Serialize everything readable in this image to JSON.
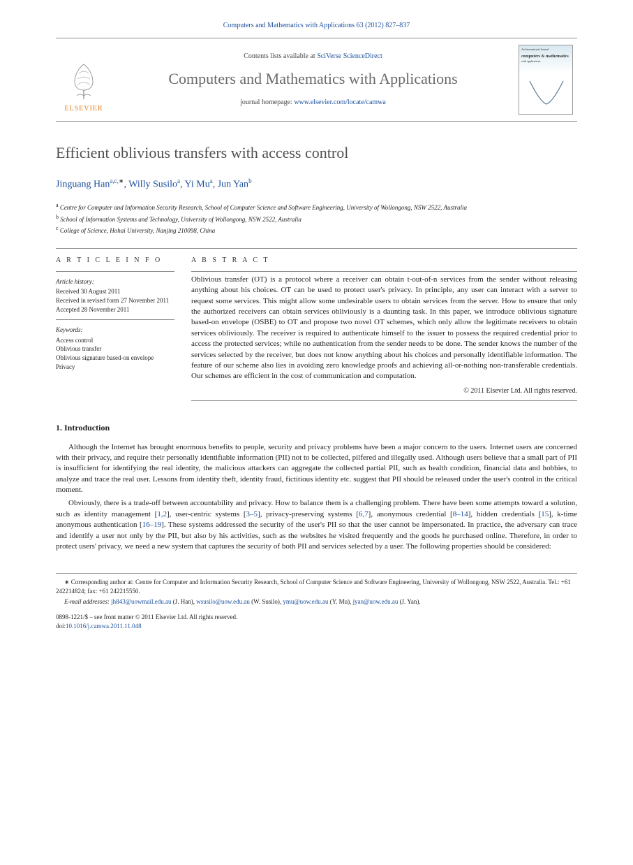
{
  "header": {
    "journal_citation": "Computers and Mathematics with Applications 63 (2012) 827–837",
    "contents_prefix": "Contents lists available at ",
    "contents_link": "SciVerse ScienceDirect",
    "journal_title": "Computers and Mathematics with Applications",
    "homepage_prefix": "journal homepage: ",
    "homepage_link": "www.elsevier.com/locate/camwa",
    "publisher": "ELSEVIER",
    "cover_title": "computers & mathematics",
    "cover_sub": "with applications"
  },
  "article": {
    "title": "Efficient oblivious transfers with access control",
    "authors_html": [
      {
        "name": "Jinguang Han",
        "affil": "a,c,",
        "star": true
      },
      {
        "name": "Willy Susilo",
        "affil": "a"
      },
      {
        "name": "Yi Mu",
        "affil": "a"
      },
      {
        "name": "Jun Yan",
        "affil": "b"
      }
    ],
    "affiliations": [
      {
        "sup": "a",
        "text": "Centre for Computer and Information Security Research, School of Computer Science and Software Engineering, University of Wollongong, NSW 2522, Australia"
      },
      {
        "sup": "b",
        "text": "School of Information Systems and Technology, University of Wollongong, NSW 2522, Australia"
      },
      {
        "sup": "c",
        "text": "College of Science, Hohai University, Nanjing 210098, China"
      }
    ]
  },
  "info": {
    "heading": "A R T I C L E   I N F O",
    "history_label": "Article history:",
    "history": [
      "Received 30 August 2011",
      "Received in revised form 27 November 2011",
      "Accepted 28 November 2011"
    ],
    "keywords_label": "Keywords:",
    "keywords": [
      "Access control",
      "Oblivious transfer",
      "Oblivious signature based-on envelope",
      "Privacy"
    ]
  },
  "abstract": {
    "heading": "A B S T R A C T",
    "body": "Oblivious transfer (OT) is a protocol where a receiver can obtain t-out-of-n services from the sender without releasing anything about his choices. OT can be used to protect user's privacy. In principle, any user can interact with a server to request some services. This might allow some undesirable users to obtain services from the server. How to ensure that only the authorized receivers can obtain services obliviously is a daunting task. In this paper, we introduce oblivious signature based-on envelope (OSBE) to OT and propose two novel OT schemes, which only allow the legitimate receivers to obtain services obliviously. The receiver is required to authenticate himself to the issuer to possess the required credential prior to access the protected services; while no authentication from the sender needs to be done. The sender knows the number of the services selected by the receiver, but does not know anything about his choices and personally identifiable information. The feature of our scheme also lies in avoiding zero knowledge proofs and achieving all-or-nothing non-transferable credentials. Our schemes are efficient in the cost of communication and computation.",
    "copyright": "© 2011 Elsevier Ltd. All rights reserved."
  },
  "sections": {
    "intro_heading": "1. Introduction",
    "intro_p1": "Although the Internet has brought enormous benefits to people, security and privacy problems have been a major concern to the users. Internet users are concerned with their privacy, and require their personally identifiable information (PII) not to be collected, pilfered and illegally used. Although users believe that a small part of PII is insufficient for identifying the real identity, the malicious attackers can aggregate the collected partial PII, such as health condition, financial data and hobbies, to analyze and trace the real user. Lessons from identity theft, identity fraud, fictitious identity etc. suggest that PII should be released under the user's control in the critical moment.",
    "intro_p2_a": "Obviously, there is a trade-off between accountability and privacy. How to balance them is a challenging problem. There have been some attempts toward a solution, such as identity management [",
    "intro_p2_link1": "1,2",
    "intro_p2_b": "], user-centric systems [",
    "intro_p2_link2": "3–5",
    "intro_p2_c": "], privacy-preserving systems [",
    "intro_p2_link3": "6,7",
    "intro_p2_d": "], anonymous credential [",
    "intro_p2_link4": "8–14",
    "intro_p2_e": "], hidden credentials [",
    "intro_p2_link5": "15",
    "intro_p2_f": "], k-time anonymous authentication [",
    "intro_p2_link6": "16–19",
    "intro_p2_g": "]. These systems addressed the security of the user's PII so that the user cannot be impersonated. In practice, the adversary can trace and identify a user not only by the PII, but also by his activities, such as the websites he visited frequently and the goods he purchased online. Therefore, in order to protect users' privacy, we need a new system that captures the security of both PII and services selected by a user. The following properties should be considered:"
  },
  "footnotes": {
    "corresponding_label": "Corresponding author at: Centre for Computer and Information Security Research, School of Computer Science and Software Engineering, University of Wollongong, NSW 2522, Australia. Tel.: +61 242214824; fax: +61 242215550.",
    "email_label": "E-mail addresses:",
    "emails": [
      {
        "email": "jh843@uowmail.edu.au",
        "who": "(J. Han)"
      },
      {
        "email": "wsusilo@uow.edu.au",
        "who": "(W. Susilo)"
      },
      {
        "email": "ymu@uow.edu.au",
        "who": "(Y. Mu)"
      },
      {
        "email": "jyan@uow.edu.au",
        "who": "(J. Yan)"
      }
    ]
  },
  "front_matter": {
    "line1": "0898-1221/$ – see front matter © 2011 Elsevier Ltd. All rights reserved.",
    "doi_label": "doi:",
    "doi": "10.1016/j.camwa.2011.11.048"
  }
}
